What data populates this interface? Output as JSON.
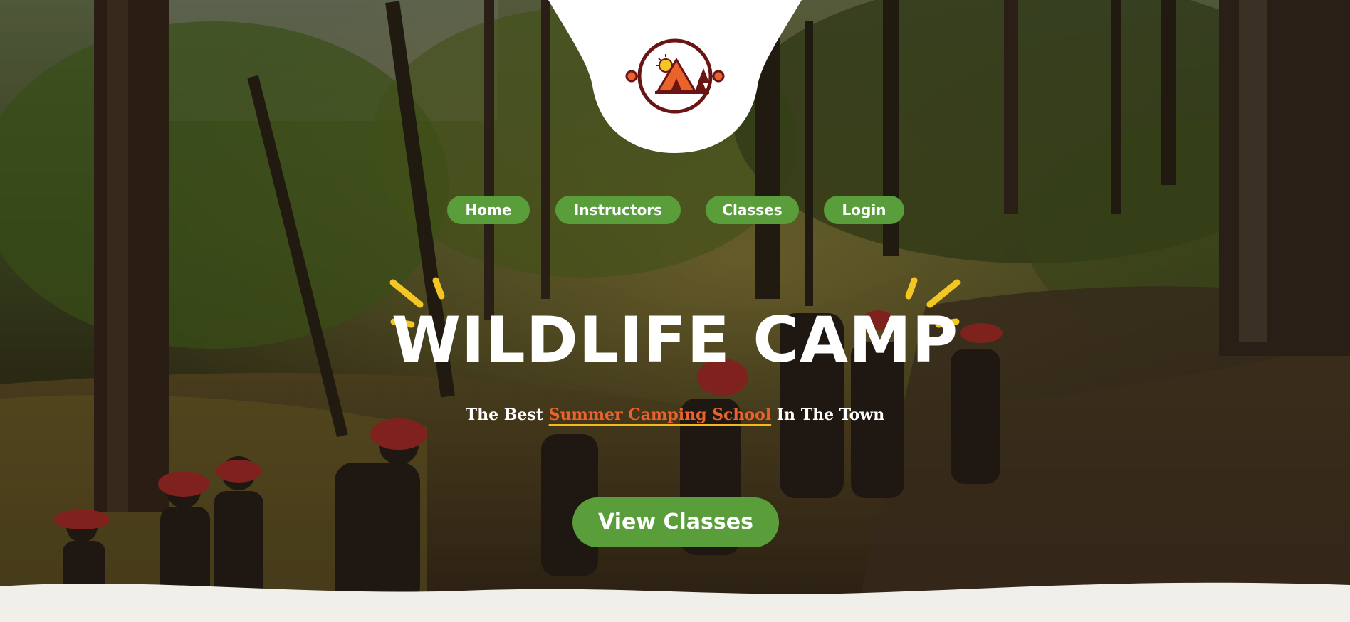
{
  "site": {
    "logo_icon": "camp-tent-sun-tree-icon"
  },
  "nav": {
    "items": [
      {
        "label": "Home"
      },
      {
        "label": "Instructors"
      },
      {
        "label": "Classes"
      },
      {
        "label": "Login"
      }
    ]
  },
  "hero": {
    "title": "WILDLIFE CAMP",
    "subtitle_pre": "The Best ",
    "subtitle_highlight": "Summer Camping School",
    "subtitle_post": " In The Town",
    "cta_label": "View Classes",
    "background_image": "forest-hiking-kids-photo"
  },
  "colors": {
    "accent_green": "#5a9e3b",
    "highlight_orange": "#e9632b",
    "underline_yellow": "#f3b81d",
    "logo_maroon": "#6b1414",
    "ray_yellow": "#f3c623",
    "page_bg": "#f1efea"
  }
}
